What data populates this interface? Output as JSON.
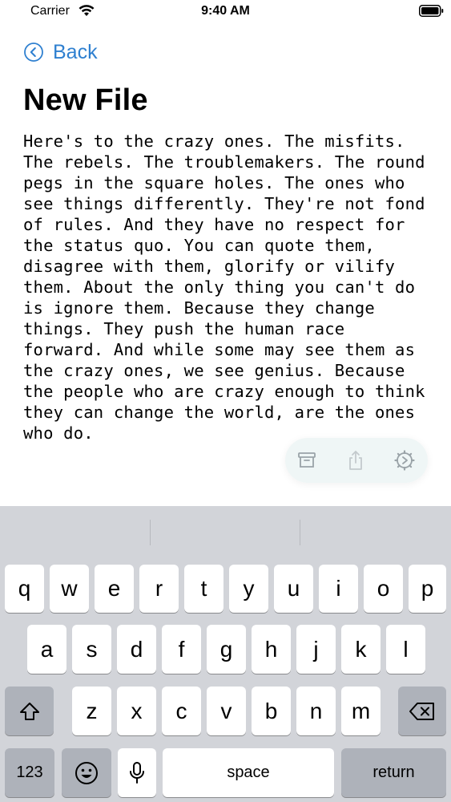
{
  "status_bar": {
    "carrier": "Carrier",
    "time": "9:40 AM"
  },
  "nav": {
    "back_label": "Back"
  },
  "page": {
    "title": "New File"
  },
  "editor": {
    "text": "Here's to the crazy ones. The misfits. The rebels. The troublemakers. The round pegs in the square holes. The ones who see things differently. They're not fond of rules. And they have no respect for the status quo. You can quote them, disagree with them, glorify or vilify them. About the only thing you can't do is ignore them. Because they change things. They push the human race forward. And while some may see them as the crazy ones, we see genius. Because the people who are crazy enough to think they can change the world, are the ones who do."
  },
  "toolbar": {
    "icons": [
      "archive-icon",
      "share-icon",
      "settings-icon"
    ]
  },
  "keyboard": {
    "row1": [
      "q",
      "w",
      "e",
      "r",
      "t",
      "y",
      "u",
      "i",
      "o",
      "p"
    ],
    "row2": [
      "a",
      "s",
      "d",
      "f",
      "g",
      "h",
      "j",
      "k",
      "l"
    ],
    "row3": [
      "z",
      "x",
      "c",
      "v",
      "b",
      "n",
      "m"
    ],
    "numbers_label": "123",
    "space_label": "space",
    "return_label": "return"
  },
  "colors": {
    "accent": "#2f80d0",
    "keyboard_bg": "#d2d4d9",
    "key_dark": "#aeb2ba"
  }
}
